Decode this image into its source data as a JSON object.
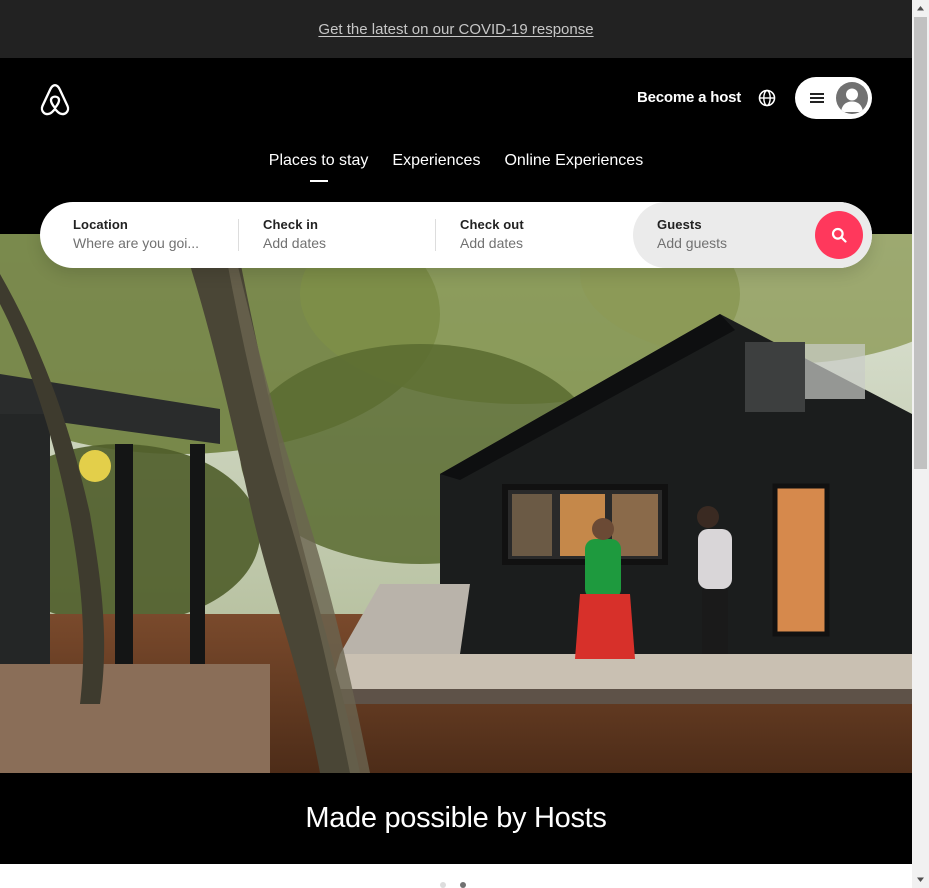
{
  "banner": {
    "link_text": "Get the latest on our COVID-19 response"
  },
  "header": {
    "logo_icon": "airbnb-logo-icon",
    "become_host": "Become a host",
    "globe_icon": "globe-icon",
    "menu_icon": "hamburger-menu-icon",
    "avatar_icon": "user-avatar-icon"
  },
  "tabs": [
    {
      "label": "Places to stay",
      "active": true
    },
    {
      "label": "Experiences",
      "active": false
    },
    {
      "label": "Online Experiences",
      "active": false
    }
  ],
  "search": {
    "location": {
      "label": "Location",
      "placeholder": "Where are you goi..."
    },
    "checkin": {
      "label": "Check in",
      "value": "Add dates"
    },
    "checkout": {
      "label": "Check out",
      "value": "Add dates"
    },
    "guests": {
      "label": "Guests",
      "value": "Add guests"
    },
    "button_icon": "search-icon"
  },
  "hero": {
    "image": "cabin-with-hosts-photo",
    "caption": "Made possible by Hosts"
  },
  "carousel": {
    "dots": 2,
    "active_index": 1
  },
  "colors": {
    "accent": "#ff385c",
    "banner_bg": "#222222",
    "header_bg": "#000000"
  }
}
